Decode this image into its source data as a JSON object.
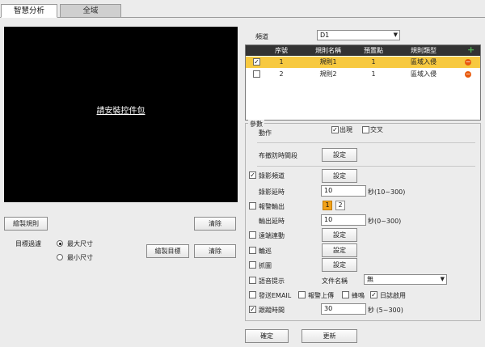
{
  "tabs": {
    "active": "智慧分析",
    "inactive": "全域"
  },
  "video": {
    "placeholder_text": "請安裝控件包"
  },
  "left": {
    "draw_rule_button": "繪製規則",
    "clear_button_1": "清除",
    "target_filter_label": "目標過濾",
    "max_size_label": "最大尺寸",
    "min_size_label": "最小尺寸",
    "max_size_selected": true,
    "draw_target_button": "繪製目標",
    "clear_button_2": "清除"
  },
  "channel": {
    "label": "頻道",
    "value": "D1"
  },
  "rules_table": {
    "headers": [
      "序號",
      "規則名稱",
      "預置點",
      "規則類型"
    ],
    "rows": [
      {
        "checked": true,
        "index": "1",
        "name": "規則1",
        "preset": "1",
        "type": "區域入侵"
      },
      {
        "checked": false,
        "index": "2",
        "name": "規則2",
        "preset": "1",
        "type": "區域入侵"
      }
    ]
  },
  "params": {
    "legend": "參數",
    "action_label": "動作",
    "action_appear_label": "出現",
    "action_appear_checked": true,
    "action_cross_label": "交叉",
    "action_cross_checked": false,
    "schedule_label": "布撤防時間段",
    "settings_label": "設定",
    "record_channel_label": "錄影頻道",
    "record_channel_checked": true,
    "record_delay_label": "錄影延時",
    "record_delay_value": "10",
    "record_delay_unit": "秒(10~300)",
    "alarm_out_label": "報警輸出",
    "alarm_out_checked": false,
    "alarm_out_options": [
      "1",
      "2"
    ],
    "alarm_out_selected": "1",
    "output_delay_label": "輸出延時",
    "output_delay_value": "10",
    "output_delay_unit": "秒(0~300)",
    "linkage_label": "遠端連動",
    "linkage_checked": false,
    "tour_label": "輪巡",
    "tour_checked": false,
    "snapshot_label": "抓圖",
    "snapshot_checked": false,
    "voice_label": "語音提示",
    "voice_checked": false,
    "file_name_label": "文件名稱",
    "file_name_value": "無",
    "email_label": "發送EMAIL",
    "email_checked": false,
    "alarm_upload_label": "報警上傳",
    "alarm_upload_checked": false,
    "buzzer_label": "蜂鳴",
    "buzzer_checked": false,
    "log_label": "日誌啟用",
    "log_checked": true,
    "tracking_label": "跟蹤時間",
    "tracking_checked": true,
    "tracking_value": "30",
    "tracking_unit": "秒 (5~300)"
  },
  "footer": {
    "ok_button": "確定",
    "refresh_button": "更新"
  },
  "colors": {
    "selected_row": "#f7c940",
    "alarm_selected": "#f2a21a",
    "delete_icon": "#e8590c",
    "add_icon": "#4caf50"
  }
}
